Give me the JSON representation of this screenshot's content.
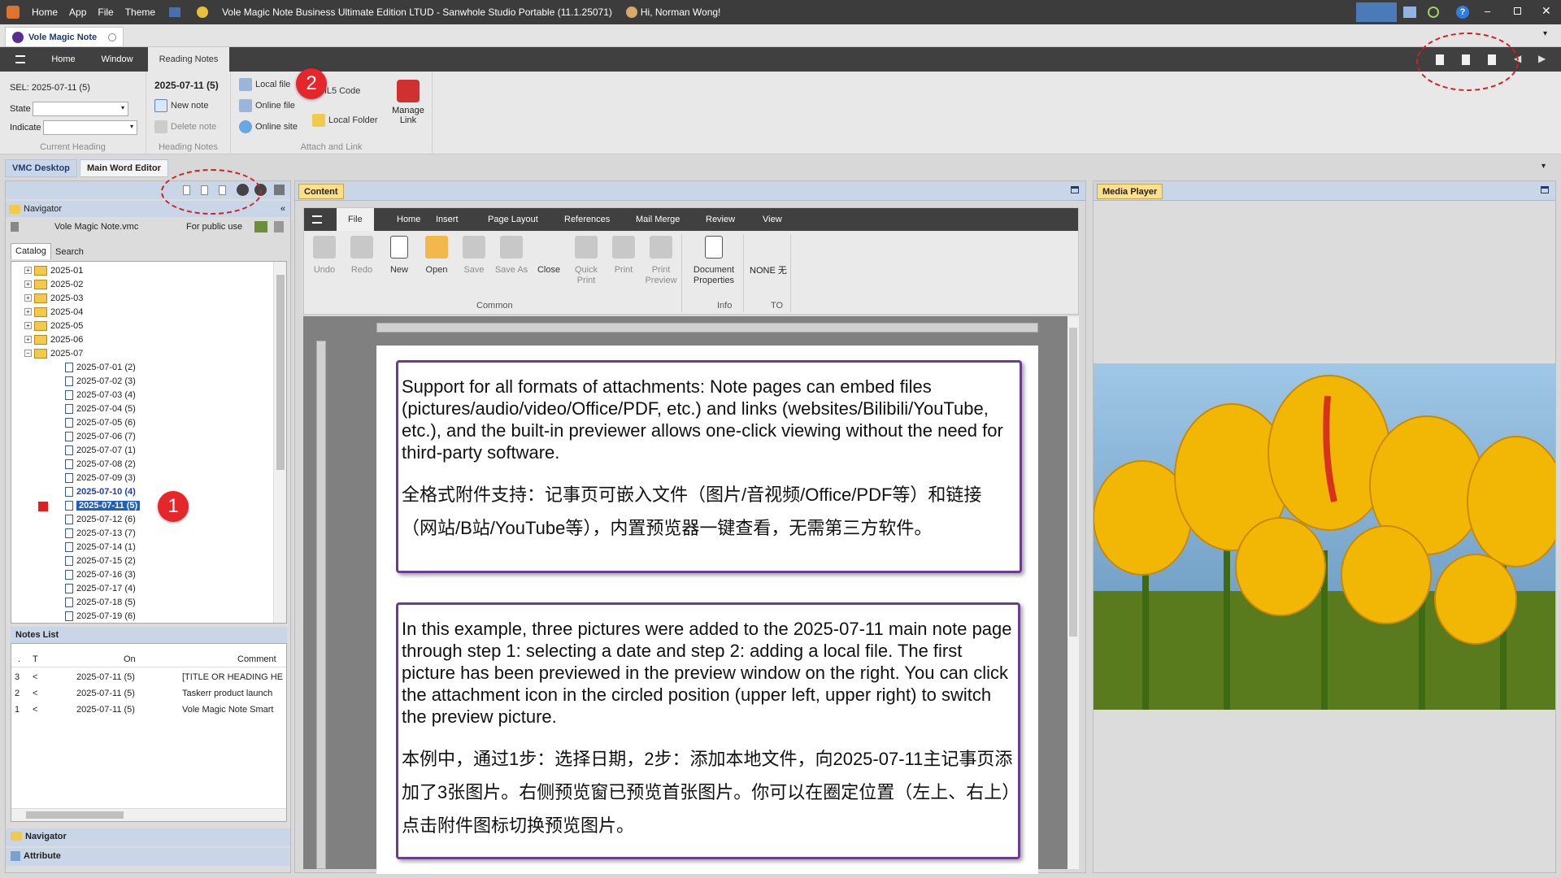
{
  "titlebar": {
    "menus": [
      "Home",
      "App",
      "File",
      "Theme"
    ],
    "title": "Vole Magic Note Business Ultimate Edition LTUD - Sanwhole Studio Portable (11.1.25071)",
    "greeting": "Hi, Norman Wong!"
  },
  "doc_tab": {
    "label": "Vole Magic Note"
  },
  "ribbon": {
    "tabs": [
      "Home",
      "Window",
      "Reading Notes"
    ],
    "current_heading": {
      "sel": "SEL: 2025-07-11 (5)",
      "state_label": "State",
      "indicate_label": "Indicate",
      "group_label": "Current Heading"
    },
    "heading_notes": {
      "date": "2025-07-11 (5)",
      "new_note": "New note",
      "delete_note": "Delete note",
      "group_label": "Heading Notes"
    },
    "attach": {
      "local_file": "Local file",
      "online_file": "Online file",
      "online_site": "Online site",
      "html5": "HTML5 Code",
      "local_folder": "Local Folder",
      "manage_link": "Manage Link",
      "group_label": "Attach and Link"
    }
  },
  "workspace_tabs": [
    "VMC Desktop",
    "Main Word Editor"
  ],
  "navigator": {
    "title": "Navigator",
    "file": "Vole Magic Note.vmc",
    "scope": "For public use",
    "tabs": [
      "Catalog",
      "Search"
    ],
    "folders": [
      "2025-01",
      "2025-02",
      "2025-03",
      "2025-04",
      "2025-05",
      "2025-06",
      "2025-07"
    ],
    "days": [
      "2025-07-01 (2)",
      "2025-07-02 (3)",
      "2025-07-03 (4)",
      "2025-07-04 (5)",
      "2025-07-05 (6)",
      "2025-07-06 (7)",
      "2025-07-07 (1)",
      "2025-07-08 (2)",
      "2025-07-09 (3)",
      "2025-07-10 (4)",
      "2025-07-11 (5)",
      "2025-07-12 (6)",
      "2025-07-13 (7)",
      "2025-07-14 (1)",
      "2025-07-15 (2)",
      "2025-07-16 (3)",
      "2025-07-17 (4)",
      "2025-07-18 (5)",
      "2025-07-19 (6)"
    ]
  },
  "notes_list": {
    "title": "Notes List",
    "headers": {
      "dot": ".",
      "t": "T",
      "on": "On",
      "comment": "Comment"
    },
    "rows": [
      {
        "n": "3",
        "t": "<",
        "on": "2025-07-11 (5)",
        "comment": "[TITLE OR HEADING HE"
      },
      {
        "n": "2",
        "t": "<",
        "on": "2025-07-11 (5)",
        "comment": "Taskerr product launch"
      },
      {
        "n": "1",
        "t": "<",
        "on": "2025-07-11 (5)",
        "comment": "Vole Magic Note Smart"
      }
    ]
  },
  "bottom_panels": [
    "Navigator",
    "Attribute"
  ],
  "content": {
    "title": "Content",
    "word_tabs": [
      "File",
      "Home",
      "Insert",
      "Page Layout",
      "References",
      "Mail Merge",
      "Review",
      "View"
    ],
    "buttons": {
      "undo": "Undo",
      "redo": "Redo",
      "new": "New",
      "open": "Open",
      "save": "Save",
      "save_as": "Save As",
      "close": "Close",
      "quick_print": "Quick Print",
      "print": "Print",
      "print_preview": "Print Preview",
      "doc_props": "Document Properties",
      "none": "NONE 无"
    },
    "groups": {
      "common": "Common",
      "info": "Info",
      "to": "TO"
    },
    "box1": {
      "en": "Support for all formats of attachments: Note pages can embed files (pictures/audio/video/Office/PDF, etc.) and links (websites/Bilibili/YouTube, etc.), and the built-in previewer allows one-click viewing without the need for third-party software.",
      "cn": "全格式附件支持：记事页可嵌入文件（图片/音视频/Office/PDF等）和链接（网站/B站/YouTube等），内置预览器一键查看，无需第三方软件。"
    },
    "box2": {
      "en": "In this example, three pictures were added to the 2025-07-11 main note page through step 1: selecting a date and step 2: adding a local file. The first picture has been previewed in the preview window on the right. You can click the attachment icon in the circled position (upper left, upper right) to switch the preview picture.",
      "cn": "本例中，通过1步：选择日期，2步：添加本地文件，向2025-07-11主记事页添加了3张图片。右侧预览窗已预览首张图片。你可以在圈定位置（左上、右上）点击附件图标切换预览图片。"
    }
  },
  "media": {
    "title": "Media Player"
  },
  "callouts": [
    "1",
    "2"
  ],
  "colors": {
    "accent": "#6a3d8f",
    "badge": "#e5262b",
    "tulip": "#f2b705"
  }
}
